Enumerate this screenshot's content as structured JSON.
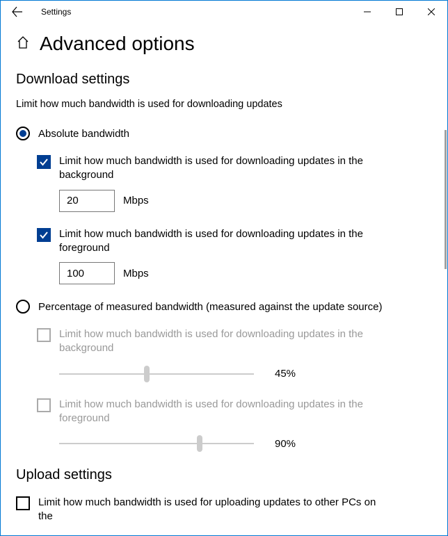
{
  "titlebar": {
    "title": "Settings"
  },
  "page": {
    "title": "Advanced options"
  },
  "download": {
    "section_title": "Download settings",
    "description": "Limit how much bandwidth is used for downloading updates",
    "absolute": {
      "label": "Absolute bandwidth",
      "bg_label": "Limit how much bandwidth is used for downloading updates in the background",
      "bg_value": "20",
      "bg_unit": "Mbps",
      "fg_label": "Limit how much bandwidth is used for downloading updates in the foreground",
      "fg_value": "100",
      "fg_unit": "Mbps"
    },
    "percentage": {
      "label": "Percentage of measured bandwidth (measured against the update source)",
      "bg_label": "Limit how much bandwidth is used for downloading updates in the background",
      "bg_value": "45%",
      "bg_pct": 45,
      "fg_label": "Limit how much bandwidth is used for downloading updates in the foreground",
      "fg_value": "90%",
      "fg_pct": 72
    }
  },
  "upload": {
    "section_title": "Upload settings",
    "limit_label": "Limit how much bandwidth is used for uploading updates to other PCs on the"
  }
}
